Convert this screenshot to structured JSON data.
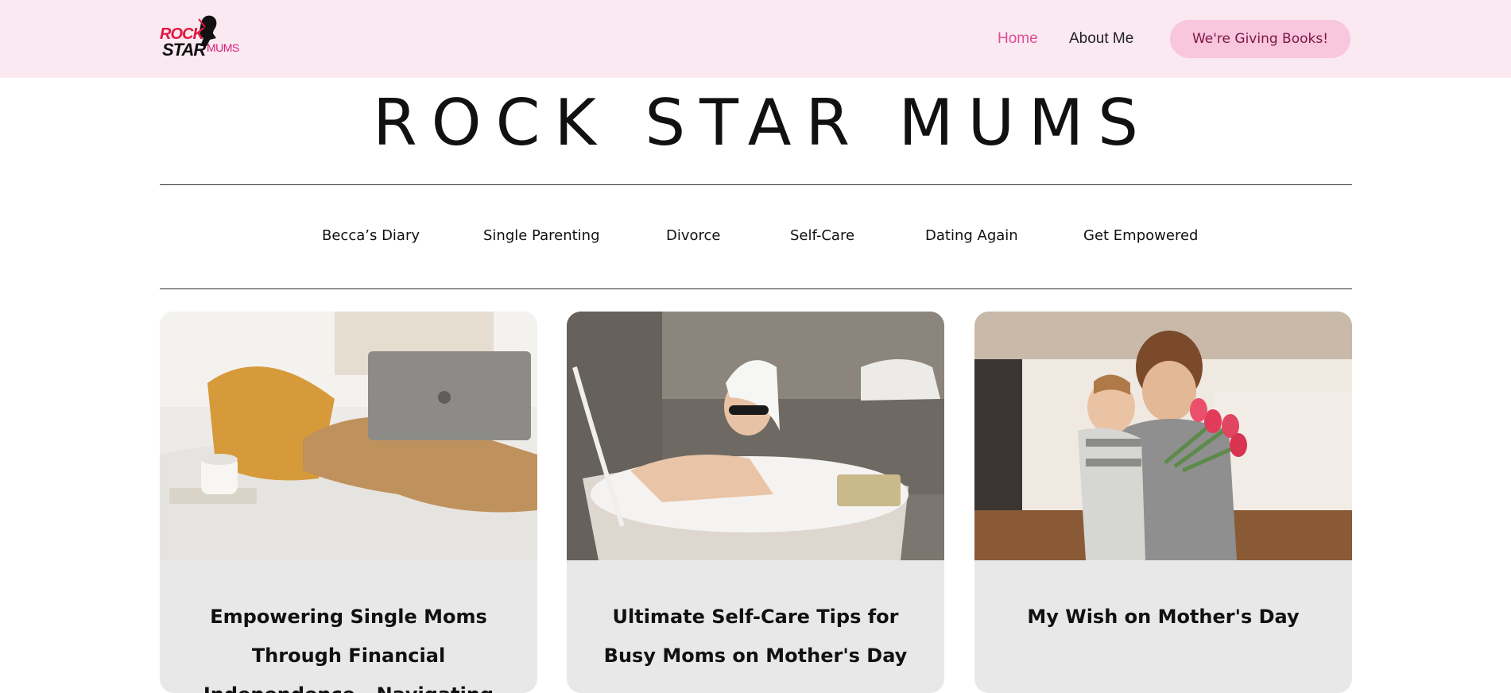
{
  "header": {
    "logo": {
      "word1": "ROCK",
      "word2": "STAR",
      "word3": "MUMS"
    },
    "nav": [
      {
        "label": "Home",
        "active": true
      },
      {
        "label": "About Me",
        "active": false
      }
    ],
    "cta_label": "We're Giving Books!"
  },
  "site_title": "ROCK STAR MUMS",
  "categories": [
    "Becca’s Diary",
    "Single Parenting",
    "Divorce",
    "Self-Care",
    "Dating Again",
    "Get Empowered"
  ],
  "cards": [
    {
      "title": "Empowering Single Moms Through Financial Independence - Navigating",
      "image": "woman-with-laptop-on-bed"
    },
    {
      "title": "Ultimate Self-Care Tips for Busy Moms on Mother's Day",
      "image": "woman-in-bubble-bath"
    },
    {
      "title": "My Wish on Mother's Day",
      "image": "mother-and-son-with-tulips"
    }
  ],
  "colors": {
    "topbar_bg": "#fbe9f2",
    "accent_pink": "#e24e94",
    "cta_bg": "#f8c6dd",
    "cta_text": "#7a1747",
    "card_bg": "#e8e8e8"
  }
}
